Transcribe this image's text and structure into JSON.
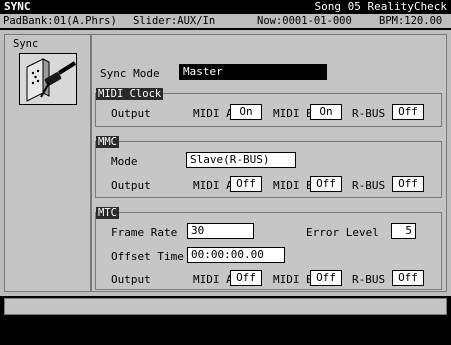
{
  "title": {
    "screen": "SYNC",
    "song": "Song 05 RealityCheck"
  },
  "status": {
    "padbank": "PadBank:01(A.Phrs)",
    "slider": "Slider:AUX/In",
    "now": "Now:0001-01-000",
    "bpm": "BPM:120.00"
  },
  "left": {
    "label": "Sync",
    "icon": "midi-connector-icon"
  },
  "sync_mode": {
    "label": "Sync Mode",
    "value": "Master"
  },
  "midi_clock": {
    "tag": "MIDI Clock",
    "output_label": "Output",
    "midi_a_label": "MIDI A",
    "midi_a_value": "On",
    "midi_b_label": "MIDI B",
    "midi_b_value": "On",
    "rbus_label": "R-BUS",
    "rbus_value": "Off"
  },
  "mmc": {
    "tag": "MMC",
    "mode_label": "Mode",
    "mode_value": "Slave(R-BUS)",
    "output_label": "Output",
    "midi_a_label": "MIDI A",
    "midi_a_value": "Off",
    "midi_b_label": "MIDI B",
    "midi_b_value": "Off",
    "rbus_label": "R-BUS",
    "rbus_value": "Off"
  },
  "mtc": {
    "tag": "MTC",
    "frame_rate_label": "Frame Rate",
    "frame_rate_value": "30",
    "error_level_label": "Error Level",
    "error_level_value": "5",
    "offset_time_label": "Offset Time",
    "offset_time_value": "00:00:00.00",
    "output_label": "Output",
    "midi_a_label": "MIDI A",
    "midi_a_value": "Off",
    "midi_b_label": "MIDI B",
    "midi_b_value": "Off",
    "rbus_label": "R-BUS",
    "rbus_value": "Off"
  },
  "colors": {
    "background": "#bdbdbd",
    "title_bar": "#000000",
    "selected_field": "#000000",
    "field": "#ffffff"
  }
}
